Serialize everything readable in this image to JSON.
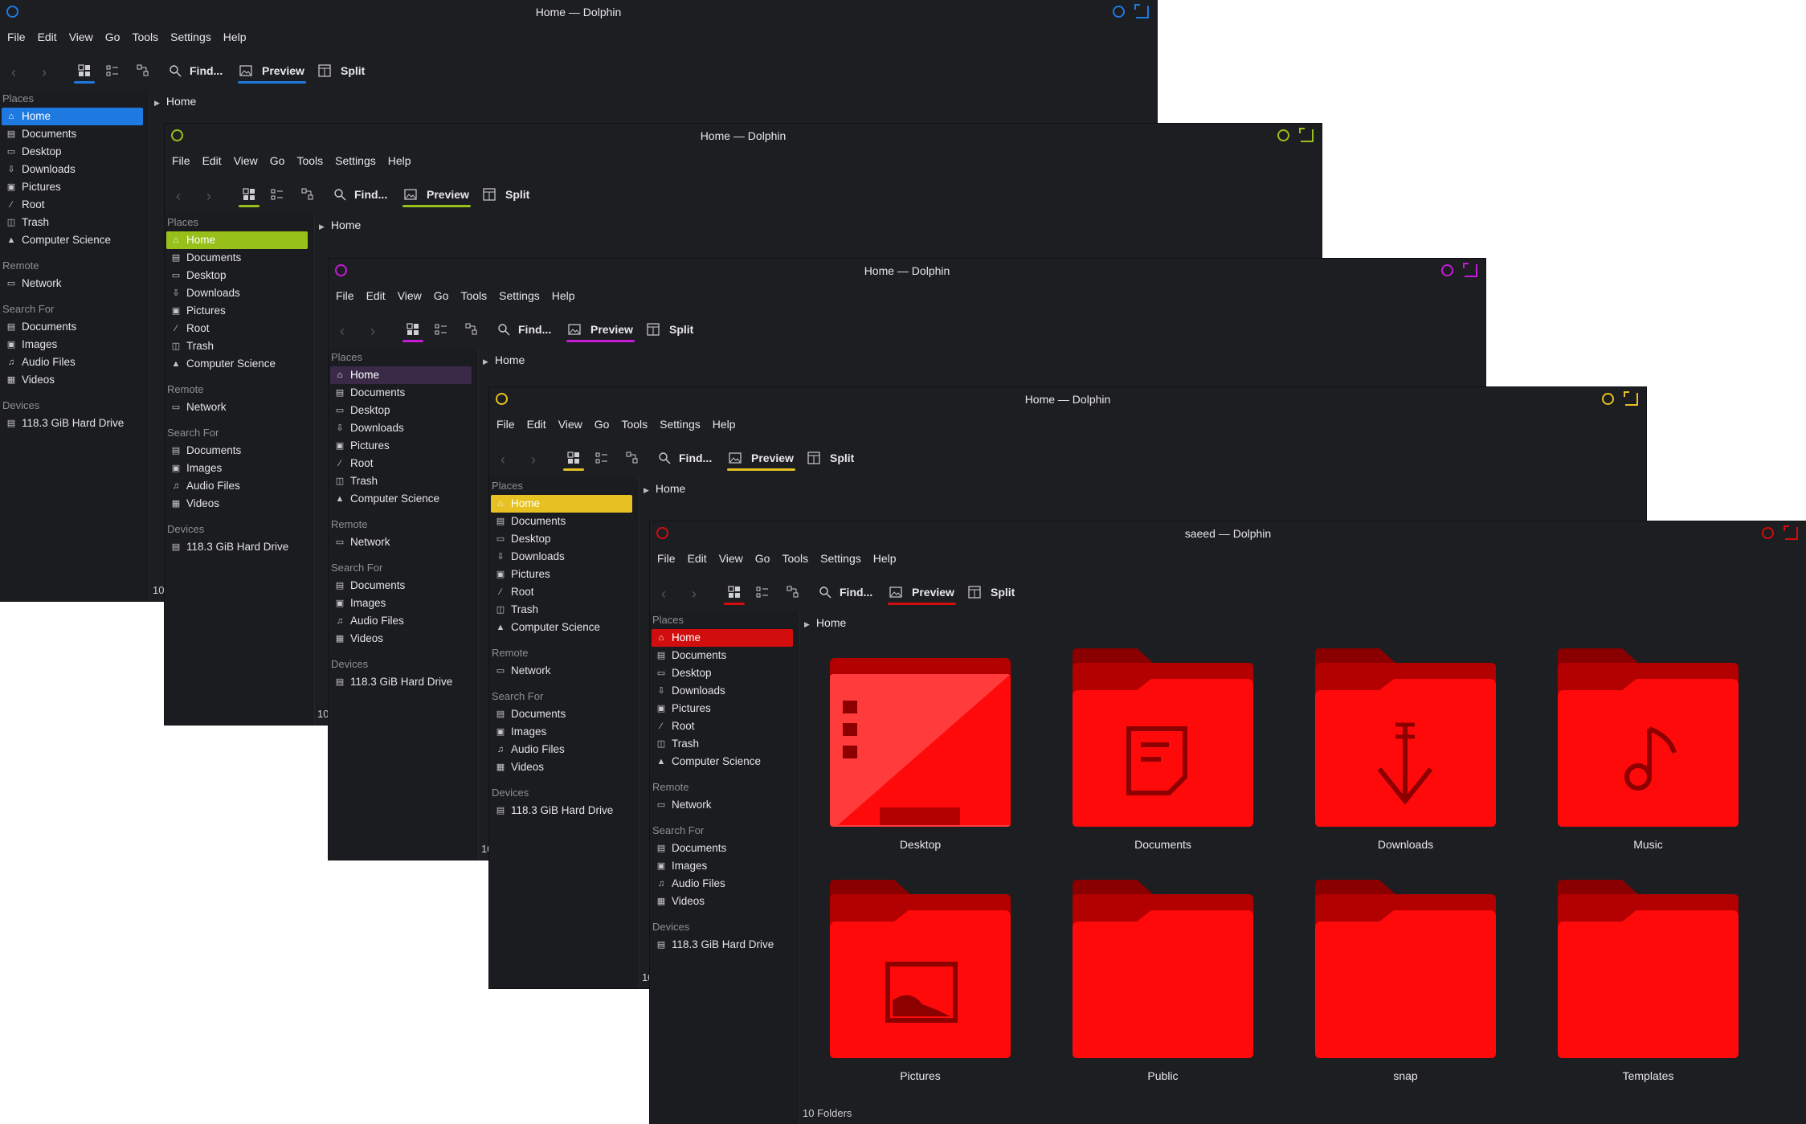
{
  "windows": [
    {
      "id": "w1",
      "title": "Home — Dolphin",
      "accent": "#1e7ae0",
      "menu": [
        "File",
        "Edit",
        "View",
        "Go",
        "Tools",
        "Settings",
        "Help"
      ],
      "toolbar": {
        "find": "Find...",
        "preview": "Preview",
        "split": "Split"
      },
      "breadcrumb": "Home",
      "sidebar": {
        "places_title": "Places",
        "places": [
          "Home",
          "Documents",
          "Desktop",
          "Downloads",
          "Pictures",
          "Root",
          "Trash",
          "Computer Science"
        ],
        "remote_title": "Remote",
        "remote": [
          "Network"
        ],
        "search_title": "Search For",
        "search": [
          "Documents",
          "Images",
          "Audio Files",
          "Videos"
        ],
        "devices_title": "Devices",
        "devices": [
          "118.3 GiB Hard Drive"
        ]
      },
      "status": "10"
    },
    {
      "id": "w2",
      "title": "Home — Dolphin",
      "accent": "#97c11a",
      "menu": [
        "File",
        "Edit",
        "View",
        "Go",
        "Tools",
        "Settings",
        "Help"
      ],
      "toolbar": {
        "find": "Find...",
        "preview": "Preview",
        "split": "Split"
      },
      "breadcrumb": "Home",
      "sidebar": {
        "places_title": "Places",
        "places": [
          "Home",
          "Documents",
          "Desktop",
          "Downloads",
          "Pictures",
          "Root",
          "Trash",
          "Computer Science"
        ],
        "remote_title": "Remote",
        "remote": [
          "Network"
        ],
        "search_title": "Search For",
        "search": [
          "Documents",
          "Images",
          "Audio Files",
          "Videos"
        ],
        "devices_title": "Devices",
        "devices": [
          "118.3 GiB Hard Drive"
        ]
      },
      "status": "10"
    },
    {
      "id": "w3",
      "title": "Home — Dolphin",
      "accent": "#c61ad9",
      "sel_bg": "#3a2a48",
      "menu": [
        "File",
        "Edit",
        "View",
        "Go",
        "Tools",
        "Settings",
        "Help"
      ],
      "toolbar": {
        "find": "Find...",
        "preview": "Preview",
        "split": "Split"
      },
      "breadcrumb": "Home",
      "sidebar": {
        "places_title": "Places",
        "places": [
          "Home",
          "Documents",
          "Desktop",
          "Downloads",
          "Pictures",
          "Root",
          "Trash",
          "Computer Science"
        ],
        "remote_title": "Remote",
        "remote": [
          "Network"
        ],
        "search_title": "Search For",
        "search": [
          "Documents",
          "Images",
          "Audio Files",
          "Videos"
        ],
        "devices_title": "Devices",
        "devices": [
          "118.3 GiB Hard Drive"
        ]
      },
      "status": "10"
    },
    {
      "id": "w4",
      "title": "Home — Dolphin",
      "accent": "#e6c121",
      "menu": [
        "File",
        "Edit",
        "View",
        "Go",
        "Tools",
        "Settings",
        "Help"
      ],
      "toolbar": {
        "find": "Find...",
        "preview": "Preview",
        "split": "Split"
      },
      "breadcrumb": "Home",
      "sidebar": {
        "places_title": "Places",
        "places": [
          "Home",
          "Documents",
          "Desktop",
          "Downloads",
          "Pictures",
          "Root",
          "Trash",
          "Computer Science"
        ],
        "remote_title": "Remote",
        "remote": [
          "Network"
        ],
        "search_title": "Search For",
        "search": [
          "Documents",
          "Images",
          "Audio Files",
          "Videos"
        ],
        "devices_title": "Devices",
        "devices": [
          "118.3 GiB Hard Drive"
        ]
      },
      "status": "10"
    },
    {
      "id": "w5",
      "title": "saeed — Dolphin",
      "accent": "#d10d0d",
      "menu": [
        "File",
        "Edit",
        "View",
        "Go",
        "Tools",
        "Settings",
        "Help"
      ],
      "toolbar": {
        "find": "Find...",
        "preview": "Preview",
        "split": "Split"
      },
      "breadcrumb": "Home",
      "sidebar": {
        "places_title": "Places",
        "places": [
          "Home",
          "Documents",
          "Desktop",
          "Downloads",
          "Pictures",
          "Root",
          "Trash",
          "Computer Science"
        ],
        "remote_title": "Remote",
        "remote": [
          "Network"
        ],
        "search_title": "Search For",
        "search": [
          "Documents",
          "Images",
          "Audio Files",
          "Videos"
        ],
        "devices_title": "Devices",
        "devices": [
          "118.3 GiB Hard Drive"
        ]
      },
      "folders": [
        {
          "name": "Desktop",
          "icon": "desktop-folder-icon"
        },
        {
          "name": "Documents",
          "icon": "documents-folder-icon"
        },
        {
          "name": "Downloads",
          "icon": "downloads-folder-icon"
        },
        {
          "name": "Music",
          "icon": "music-folder-icon"
        },
        {
          "name": "Pictures",
          "icon": "pictures-folder-icon"
        },
        {
          "name": "Public",
          "icon": "folder-icon"
        },
        {
          "name": "snap",
          "icon": "folder-icon"
        },
        {
          "name": "Templates",
          "icon": "folder-icon"
        }
      ],
      "folder_colors": {
        "front": "#ff0a0a",
        "back": "#b30000",
        "tab": "#8a0000",
        "glyph": "#8c0000"
      },
      "status": "10 Folders"
    }
  ]
}
